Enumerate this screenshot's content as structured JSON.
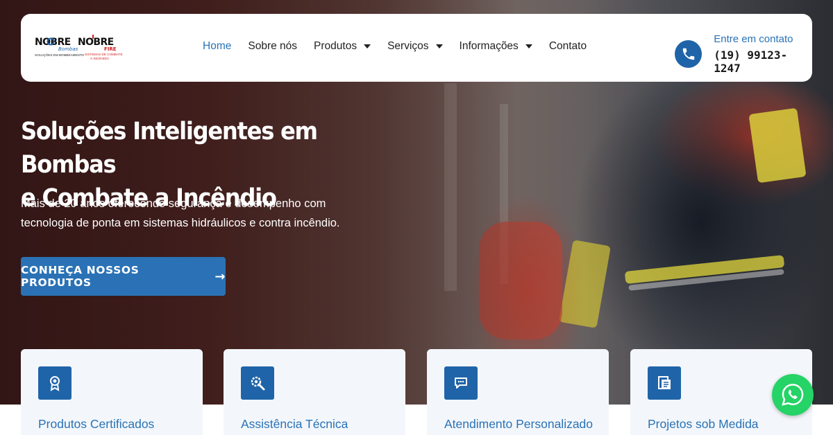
{
  "header": {
    "logo": {
      "brand_left": "NOBRE",
      "brand_left_sub": "Bombas",
      "brand_left_tagline": "SOLUÇÕES EM BOMBEAMENTO",
      "brand_right": "NOBRE",
      "brand_right_sub": "FIRE",
      "brand_right_tagline": "SISTEMAS DE COMBATE À INCÊNDIO"
    },
    "nav": [
      {
        "label": "Home",
        "active": true,
        "dropdown": false
      },
      {
        "label": "Sobre nós",
        "active": false,
        "dropdown": false
      },
      {
        "label": "Produtos",
        "active": false,
        "dropdown": true
      },
      {
        "label": "Serviços",
        "active": false,
        "dropdown": true
      },
      {
        "label": "Informações",
        "active": false,
        "dropdown": true
      },
      {
        "label": "Contato",
        "active": false,
        "dropdown": false
      }
    ],
    "contact": {
      "label": "Entre em contato",
      "phone": "(19) 99123-1247",
      "icon": "phone-icon"
    }
  },
  "hero": {
    "title_line1": "Soluções Inteligentes em Bombas",
    "title_line2": "e Combate a Incêndio",
    "subtitle_line1": "Mais de 20 anos oferecendo segurança e desempenho com",
    "subtitle_line2": "tecnologia de ponta em sistemas hidráulicos e contra incêndio.",
    "cta_label": "CONHEÇA NOSSOS PRODUTOS",
    "cta_icon": "arrow-right-icon"
  },
  "features": [
    {
      "title": "Produtos Certificados",
      "icon": "certificate-icon"
    },
    {
      "title": "Assistência Técnica",
      "icon": "gear-wrench-icon"
    },
    {
      "title": "Atendimento Personalizado",
      "icon": "chat-icon"
    },
    {
      "title": "Projetos sob Medida",
      "icon": "blueprint-icon"
    }
  ],
  "whatsapp": {
    "icon": "whatsapp-icon"
  },
  "colors": {
    "accent": "#2a72b5",
    "accent_dark": "#1f64a8",
    "whatsapp": "#25d366",
    "card_bg": "#f3f7fb"
  }
}
